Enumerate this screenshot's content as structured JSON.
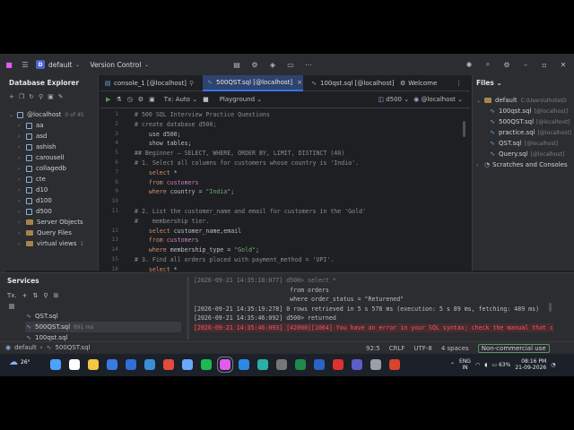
{
  "titlebar": {
    "project_badge": "D",
    "project": "default",
    "vcs": "Version Control"
  },
  "db_explorer": {
    "title": "Database Explorer",
    "host": "@localhost",
    "host_count": "0 of 45",
    "items": [
      "aa",
      "asd",
      "ashish",
      "carousell",
      "collagedb",
      "cte",
      "d10",
      "d100",
      "d500"
    ],
    "server_objects": "Server Objects",
    "query_files": "Query Files",
    "virtual_views": "virtual views",
    "virtual_views_count": "1"
  },
  "tabs": [
    {
      "label": "console_1 [@localhost]"
    },
    {
      "label": "500QST.sql [@localhost]"
    },
    {
      "label": "100qst.sql [@localhost]"
    },
    {
      "label": "Welcome"
    }
  ],
  "editor_toolbar": {
    "tx": "Tx: Auto",
    "playground": "Playground",
    "schema": "d500",
    "host": "@localhost",
    "warnings": "11",
    "checks": "10"
  },
  "code_lines": [
    {
      "n": "1",
      "parts": [
        {
          "t": "# 500 SQL Interview Practice Questions",
          "c": "cm"
        }
      ]
    },
    {
      "n": "2",
      "parts": [
        {
          "t": "# create database d500;",
          "c": "cm"
        }
      ]
    },
    {
      "n": "3",
      "parts": [
        {
          "t": "    use d500;",
          "c": "id"
        }
      ]
    },
    {
      "n": "4",
      "parts": [
        {
          "t": "    show tables;",
          "c": "id"
        }
      ]
    },
    {
      "n": "5",
      "parts": [
        {
          "t": "## Beginner — SELECT, WHERE, ORDER BY, LIMIT, DISTINCT (40)",
          "c": "cm"
        }
      ]
    },
    {
      "n": "6",
      "parts": [
        {
          "t": "# 1. Select all columns for customers whose country is 'India'.",
          "c": "cm"
        }
      ]
    },
    {
      "n": "7",
      "parts": [
        {
          "t": "    ",
          "c": "id"
        },
        {
          "t": "select",
          "c": "kw"
        },
        {
          "t": " *",
          "c": "id"
        }
      ]
    },
    {
      "n": "8",
      "parts": [
        {
          "t": "    ",
          "c": "id"
        },
        {
          "t": "from",
          "c": "kw"
        },
        {
          "t": " customers",
          "c": "tbl"
        }
      ]
    },
    {
      "n": "9",
      "parts": [
        {
          "t": "    ",
          "c": "id"
        },
        {
          "t": "where",
          "c": "kw"
        },
        {
          "t": " country = ",
          "c": "id"
        },
        {
          "t": "\"India\"",
          "c": "str"
        },
        {
          "t": ";",
          "c": "id"
        }
      ]
    },
    {
      "n": "10",
      "parts": [
        {
          "t": "",
          "c": "id"
        }
      ]
    },
    {
      "n": "11",
      "parts": [
        {
          "t": "# 2. List the customer_name and email for customers in the 'Gold'",
          "c": "cm"
        }
      ]
    },
    {
      "n": "",
      "parts": [
        {
          "t": "#    membership tier.",
          "c": "cm"
        }
      ]
    },
    {
      "n": "12",
      "parts": [
        {
          "t": "    ",
          "c": "id"
        },
        {
          "t": "select",
          "c": "kw"
        },
        {
          "t": " customer_name,email",
          "c": "id"
        }
      ]
    },
    {
      "n": "13",
      "parts": [
        {
          "t": "    ",
          "c": "id"
        },
        {
          "t": "from",
          "c": "kw"
        },
        {
          "t": " customers",
          "c": "tbl"
        }
      ]
    },
    {
      "n": "14",
      "parts": [
        {
          "t": "    ",
          "c": "id"
        },
        {
          "t": "where",
          "c": "kw"
        },
        {
          "t": " membership_type = ",
          "c": "id"
        },
        {
          "t": "\"Gold\"",
          "c": "str"
        },
        {
          "t": ";",
          "c": "id"
        }
      ]
    },
    {
      "n": "15",
      "parts": [
        {
          "t": "# 3. Find all orders placed with payment_method = 'UPI'.",
          "c": "cm"
        }
      ]
    },
    {
      "n": "16",
      "parts": [
        {
          "t": "    ",
          "c": "id"
        },
        {
          "t": "select",
          "c": "kw"
        },
        {
          "t": " *",
          "c": "id"
        }
      ]
    }
  ],
  "files": {
    "title": "Files",
    "root": "default",
    "root_path": "C:\\Users\\dhote\\D",
    "items": [
      {
        "name": "100qst.sql",
        "host": "[@localhost]"
      },
      {
        "name": "500QST.sql",
        "host": "[@localhost]"
      },
      {
        "name": "practice.sql",
        "host": "[@localhost]"
      },
      {
        "name": "QST.sql",
        "host": "[@localhost]"
      },
      {
        "name": "Query.sql",
        "host": "[@localhost]"
      }
    ],
    "scratches": "Scratches and Consoles"
  },
  "services": {
    "title": "Services",
    "tx": "Tx.",
    "items": [
      {
        "name": "QST.sql",
        "time": ""
      },
      {
        "name": "500QST.sql",
        "time": "891 ms"
      },
      {
        "name": "100qst.sql",
        "time": ""
      }
    ],
    "log": [
      {
        "t": "[2026-09-21 14:35:18:077] d500> select *",
        "c": "id"
      },
      {
        "t": "                           from orders",
        "c": "id"
      },
      {
        "t": "                           where order_status = \"Returened\"",
        "c": "id"
      },
      {
        "t": "[2026-09-21 14:35:19:278] 0 rows retrieved in 5 s 578 ms (execution: 5 s 89 ms, fetching: 489 ms)",
        "c": "id"
      },
      {
        "t": "[2026-09-21 14:35:46:092] d500> returned",
        "c": "id"
      },
      {
        "t": "[2026-09-21 14:35:46:093] [42000][1064] You have an error in your SQL syntax; check the manual that c",
        "c": "err"
      }
    ]
  },
  "status": {
    "crumb1": "default",
    "crumb2": "500QST.sql",
    "pos": "92:5",
    "eol": "CRLF",
    "enc": "UTF-8",
    "indent": "4 spaces",
    "license": "Non-commercial use"
  },
  "taskbar": {
    "temp": "26°",
    "lang1": "ENG",
    "lang2": "IN",
    "battery": "63%",
    "time": "08:16 PM",
    "date": "21-09-2026"
  },
  "colors": {
    "accent": "#3574f0",
    "panel": "#2b2d30",
    "editor": "#1e1f22"
  }
}
